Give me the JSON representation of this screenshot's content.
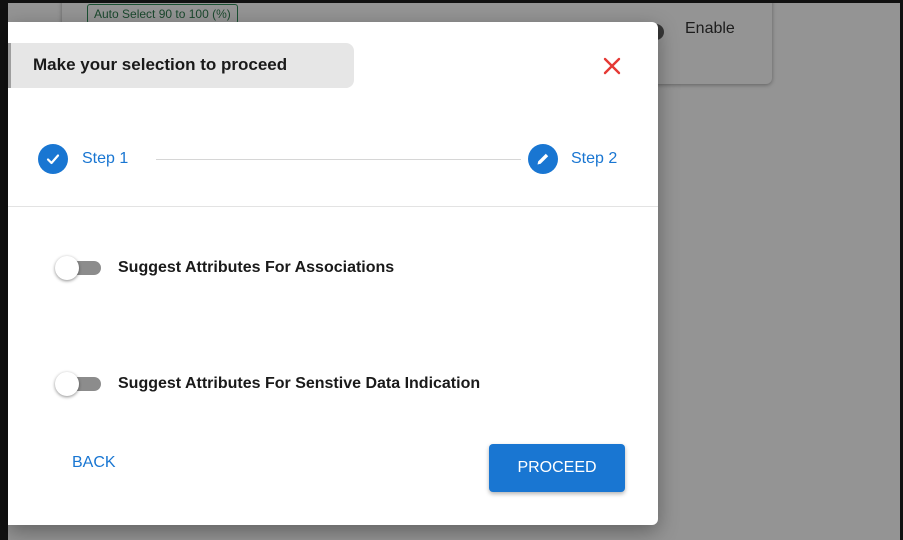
{
  "background": {
    "chip_label": "Auto Select 90 to 100 (%)",
    "enable_label": "Enable"
  },
  "dialog": {
    "title": "Make your selection to proceed",
    "close_icon": "close-icon",
    "steps": [
      {
        "label": "Step 1",
        "state": "completed",
        "icon": "check-icon"
      },
      {
        "label": "Step 2",
        "state": "active",
        "icon": "pencil-icon"
      }
    ],
    "toggles": [
      {
        "label": "Suggest Attributes For Associations",
        "checked": false
      },
      {
        "label": "Suggest Attributes For Senstive Data Indication",
        "checked": false
      }
    ],
    "back_label": "BACK",
    "proceed_label": "PROCEED"
  },
  "colors": {
    "primary": "#1976d2",
    "close": "#e53935",
    "overlay": "#6b6b6b"
  }
}
